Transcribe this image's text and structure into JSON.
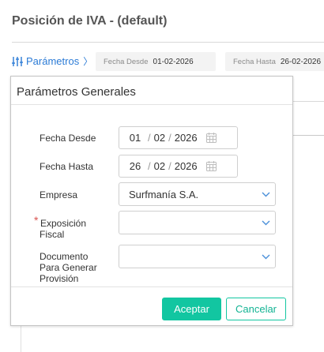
{
  "page": {
    "title": "Posición de IVA - (default)"
  },
  "params_bar": {
    "toggle_label": "Parámetros",
    "toggle_chevron": "〉",
    "fecha_desde": {
      "label": "Fecha Desde",
      "value": "01-02-2026"
    },
    "fecha_hasta": {
      "label": "Fecha Hasta",
      "value": "26-02-2026"
    }
  },
  "popover": {
    "title": "Parámetros Generales",
    "fields": {
      "fecha_desde": {
        "label": "Fecha Desde",
        "day": "01",
        "month": "02",
        "year": "2026"
      },
      "fecha_hasta": {
        "label": "Fecha Hasta",
        "day": "26",
        "month": "02",
        "year": "2026"
      },
      "empresa": {
        "label": "Empresa",
        "value": "Surfmanía S.A."
      },
      "exposicion_fiscal": {
        "label_line1": "Exposición",
        "label_line2": "Fiscal",
        "required_mark": "*",
        "value": ""
      },
      "documento": {
        "label_line1": "Documento",
        "label_line2": "Para Generar",
        "label_line3": "Provisión",
        "value": ""
      }
    },
    "date_separator": "/",
    "buttons": {
      "accept": "Aceptar",
      "cancel": "Cancelar"
    }
  },
  "icons": {
    "toggle": "sliders-icon",
    "date": "calendar-icon",
    "select": "chevron-down-icon"
  },
  "colors": {
    "link_blue": "#2b7bd6",
    "accent_green": "#12c6a1",
    "required_red": "#d9534f"
  }
}
